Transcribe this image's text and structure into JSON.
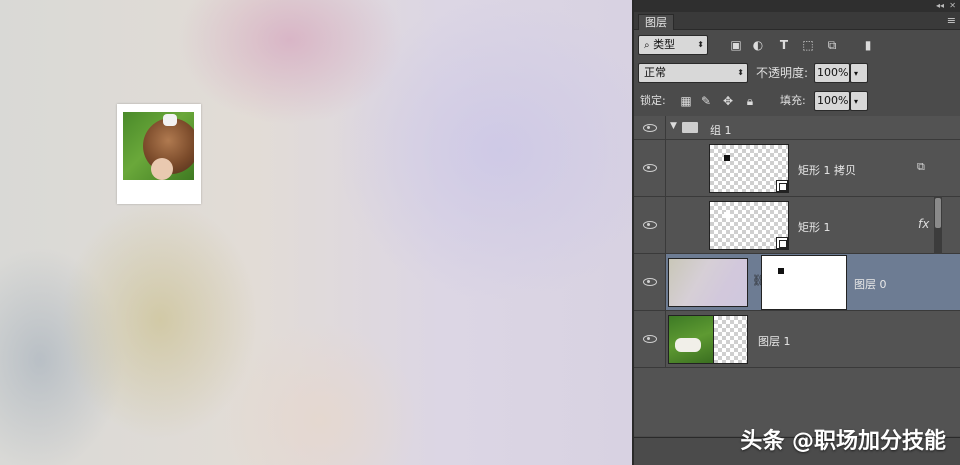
{
  "panel": {
    "tab_label": "图层",
    "filter": {
      "value": "类型"
    },
    "blend_mode": {
      "value": "正常"
    },
    "opacity": {
      "label": "不透明度:",
      "value": "100%"
    },
    "lock": {
      "label": "锁定:"
    },
    "fill": {
      "label": "填充:",
      "value": "100%"
    }
  },
  "layers": [
    {
      "name": "组 1",
      "kind": "group",
      "visible": true
    },
    {
      "name": "矩形 1 拷贝",
      "kind": "shape",
      "visible": true,
      "linked_icon": "copy-icon"
    },
    {
      "name": "矩形 1",
      "kind": "shape",
      "visible": true,
      "effect_icon": "fx"
    },
    {
      "name": "图层 0",
      "kind": "masked",
      "visible": true,
      "selected": true
    },
    {
      "name": "图层 1",
      "kind": "photo",
      "visible": true
    }
  ],
  "watermark": "头条 @职场加分技能",
  "colors": {
    "panel_bg": "#535353",
    "selected_row": "#6d7c93"
  }
}
